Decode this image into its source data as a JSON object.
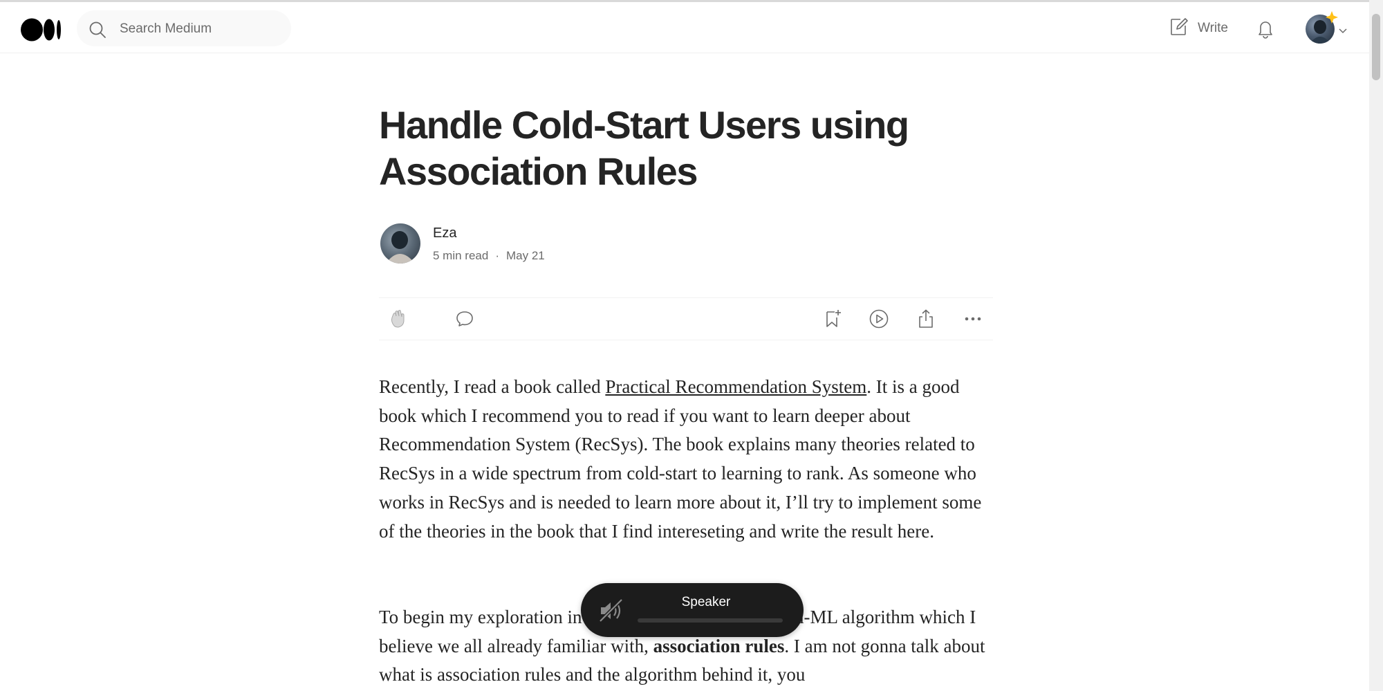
{
  "header": {
    "search_placeholder": "Search Medium",
    "write_label": "Write"
  },
  "article": {
    "title": "Handle Cold-Start Users using Association Rules",
    "author": {
      "name": "Eza",
      "read_time": "5 min read",
      "separator": "·",
      "date": "May 21"
    },
    "actions": {
      "clap_icon": "clap-icon",
      "comment_icon": "comment-icon",
      "bookmark_icon": "bookmark-add-icon",
      "listen_icon": "play-circle-icon",
      "share_icon": "share-icon",
      "more_icon": "more-horizontal-icon"
    },
    "paragraphs": [
      {
        "before_link": "Recently, I read a book called ",
        "link_text": "Practical Recommendation System",
        "after_link": ". It is a good book which I recommend you to read if you want to learn deeper about Recommendation System (RecSys). The book explains many theories related to RecSys in a wide spectrum from cold-start to learning to rank. As someone who works in RecSys and is needed to learn more about it, I’ll try to implement some of the theories in the book that I find intereseting and write the result here."
      },
      {
        "before_bold": "To begin my exploration in the book, I’ll start with a non-ML algorithm which I believe we all already familiar with, ",
        "bold_text": "association rules",
        "after_bold": ". I am not gonna talk about what is association rules and the algorithm behind it, you"
      }
    ]
  },
  "speaker_popup": {
    "label": "Speaker",
    "volume_level": 0.0,
    "icon": "speaker-muted-icon"
  },
  "colors": {
    "text": "#242424",
    "muted": "#6b6b6b",
    "popup_bg": "#1c1c1c",
    "badge": "#ffc017"
  }
}
